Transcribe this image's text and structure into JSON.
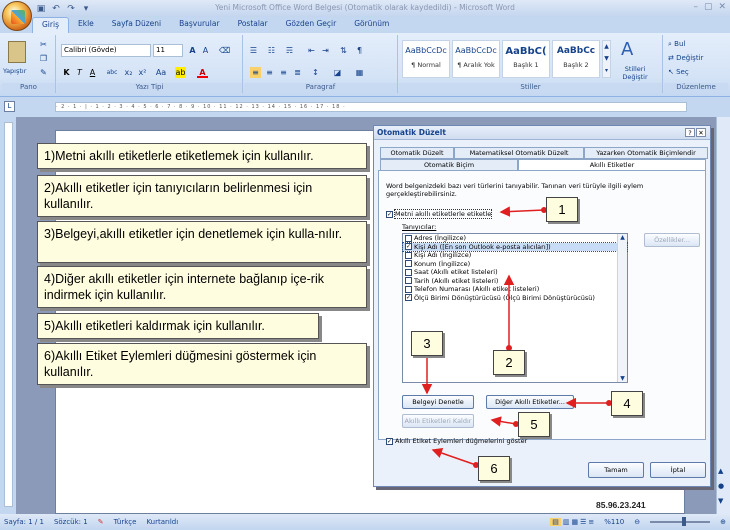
{
  "window": {
    "title": "Yeni Microsoft Office Word Belgesi (Otomatik olarak kaydedildi) - Microsoft Word"
  },
  "ribbon": {
    "tabs": [
      "Giriş",
      "Ekle",
      "Sayfa Düzeni",
      "Başvurular",
      "Postalar",
      "Gözden Geçir",
      "Görünüm"
    ],
    "active_tab": "Giriş",
    "clipboard": {
      "paste_label": "Yapıştır",
      "group_label": "Pano"
    },
    "font": {
      "name": "Calibri (Gövde)",
      "size": "11",
      "group_label": "Yazı Tipi"
    },
    "paragraph": {
      "group_label": "Paragraf"
    },
    "styles": {
      "group_label": "Stiller",
      "items": [
        {
          "preview": "AaBbCcDc",
          "label": "¶ Normal"
        },
        {
          "preview": "AaBbCcDc",
          "label": "¶ Aralık Yok"
        },
        {
          "preview": "AaBbC(",
          "label": "Başlık 1"
        },
        {
          "preview": "AaBbCc",
          "label": "Başlık 2"
        }
      ],
      "change_styles": "Stilleri Değiştir"
    },
    "editing": {
      "group_label": "Düzenleme",
      "find": "Bul",
      "replace": "Değiştir",
      "select": "Seç"
    }
  },
  "callouts": [
    "1)Metni akıllı etiketlerle etiketlemek için kullanılır.",
    "2)Akıllı etiketler için tanıyıcıların belirlenmesi için kullanılır.",
    "3)Belgeyi,akıllı etiketler için denetlemek için kulla-nılır.",
    "4)Diğer akıllı etiketler için internete bağlanıp içe-rik indirmek için kullanılır.",
    "5)Akıllı etiketleri kaldırmak için kullanılır.",
    "6)Akıllı Etiket Eylemleri düğmesini göstermek için kullanılır."
  ],
  "dialog": {
    "title": "Otomatik Düzelt",
    "tabs_row1": [
      "Otomatik Düzelt",
      "Matematiksel Otomatik Düzelt",
      "Yazarken Otomatik Biçimlendir"
    ],
    "tabs_row2": [
      "Otomatik Biçim",
      "Akıllı Etiketler"
    ],
    "active_tab": "Akıllı Etiketler",
    "description": "Word belgenizdeki bazı veri türlerini tanıyabilir. Tanınan veri türüyle ilgili eylem gerçekleştirebilirsiniz.",
    "label_checkbox": "Metni akıllı etiketlerle etiketle",
    "recognizers_label": "Tanıyıcılar:",
    "recognizers": [
      {
        "label": "Adres (İngilizce)",
        "checked": false
      },
      {
        "label": "Kişi Adı ([En son Outlook e-posta alıcıları])",
        "checked": true
      },
      {
        "label": "Kişi Adı (İngilizce)",
        "checked": false
      },
      {
        "label": "Konum (İngilizce)",
        "checked": false
      },
      {
        "label": "Saat (Akıllı etiket listeleri)",
        "checked": false
      },
      {
        "label": "Tarih (Akıllı etiket listeleri)",
        "checked": false
      },
      {
        "label": "Telefon Numarası (Akıllı etiket listeleri)",
        "checked": false
      },
      {
        "label": "Ölçü Birimi Dönüştürücüsü (Ölçü Birimi Dönüştürücüsü)",
        "checked": true
      }
    ],
    "details_button": "Özellikler...",
    "recheck_button": "Belgeyi Denetle",
    "more_button": "Diğer Akıllı Etiketler...",
    "remove_button": "Akıllı Etiketleri Kaldır",
    "show_actions_checkbox": "Akıllı Etiket Eylemleri düğmelerini göster",
    "ok": "Tamam",
    "cancel": "İptal"
  },
  "markers": [
    "1",
    "2",
    "3",
    "4",
    "5",
    "6"
  ],
  "watermark": "85.96.23.241",
  "statusbar": {
    "page": "Sayfa: 1 / 1",
    "words": "Sözcük: 1",
    "language": "Türkçe",
    "mode": "Kurtarıldı",
    "zoom": "%110"
  }
}
